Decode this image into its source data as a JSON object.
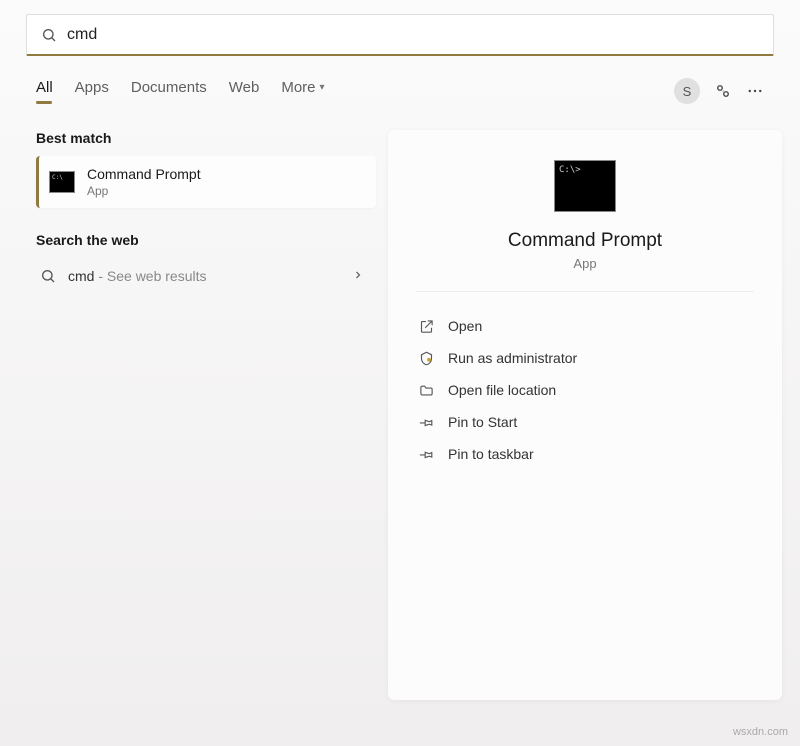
{
  "search": {
    "value": "cmd",
    "placeholder": ""
  },
  "tabs": {
    "items": [
      {
        "label": "All",
        "active": true
      },
      {
        "label": "Apps",
        "active": false
      },
      {
        "label": "Documents",
        "active": false
      },
      {
        "label": "Web",
        "active": false
      },
      {
        "label": "More",
        "active": false,
        "dropdown": true
      }
    ]
  },
  "user": {
    "initial": "S"
  },
  "sections": {
    "best_match_title": "Best match",
    "search_web_title": "Search the web"
  },
  "best_match": {
    "title": "Command Prompt",
    "subtitle": "App"
  },
  "web_result": {
    "query": "cmd",
    "hint": " - See web results"
  },
  "detail": {
    "title": "Command Prompt",
    "subtitle": "App",
    "actions": [
      {
        "icon": "open",
        "label": "Open"
      },
      {
        "icon": "admin",
        "label": "Run as administrator"
      },
      {
        "icon": "folder",
        "label": "Open file location"
      },
      {
        "icon": "pin",
        "label": "Pin to Start"
      },
      {
        "icon": "pin",
        "label": "Pin to taskbar"
      }
    ]
  },
  "watermark": "wsxdn.com"
}
